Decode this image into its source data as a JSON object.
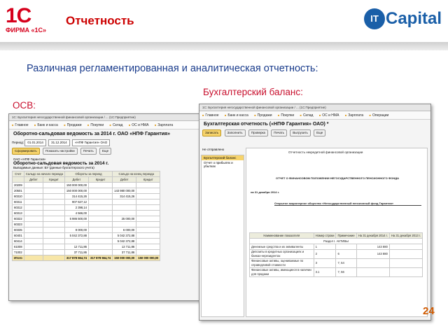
{
  "header": {
    "logo_1c_mark": "1С",
    "logo_1c_firm": "ФИРМА «1С»",
    "title": "Отчетность",
    "itcapital_ball": "IT",
    "itcapital_word": "Capital"
  },
  "subtitle": "Различная регламентированная и аналитическая отчетность:",
  "label_balance": "Бухгалтерский баланс:",
  "label_osv": "ОСВ:",
  "page_number": "24",
  "osv_window": {
    "titlebar": "1С: Бухгалтерия негосударственной финансовой организации / ... (1С:Предприятие)",
    "menu": [
      "Главное",
      "Банк и касса",
      "Продажи",
      "Покупки",
      "Склад",
      "ОС и НМА",
      "Зарплата"
    ],
    "doc_title": "Оборотно-сальдовая ведомость за 2014 г. ОАО «НПФ Гарантия»",
    "period_label": "Период:",
    "period_from": "01.01.2014",
    "period_to": "31.12.2014",
    "org": "«НПФ Гарантия» ОАО",
    "btn_form": "Сформировать",
    "btn_settings": "Показать настройки",
    "btn_print": "Печать",
    "btn_more": "Еще",
    "report_org": "ОАО «НПФ Гарантия»",
    "report_title": "Оборотно-сальдовая ведомость за 2014 г.",
    "report_note": "Выводимые данные: БУ (данные бухгалтерского учета)",
    "columns": [
      "Счет",
      "Сальдо на начало периода",
      "Обороты за период",
      "",
      "Сальдо на конец периода"
    ],
    "subcolumns": [
      "",
      "Дебет",
      "Кредит",
      "Дебет",
      "Кредит",
      "Дебет",
      "Кредит"
    ],
    "rows": [
      [
        "20209",
        "",
        "",
        "150 000 000,00",
        "",
        "",
        ""
      ],
      [
        "20501",
        "",
        "",
        "150 000 000,00",
        "",
        "143 980 000,00",
        ""
      ],
      [
        "60310",
        "",
        "",
        "314 415,26",
        "",
        "314 415,26",
        ""
      ],
      [
        "60311",
        "",
        "",
        "907 627,12",
        "",
        "",
        ""
      ],
      [
        "60312",
        "",
        "",
        "2 398,14",
        "",
        "",
        ""
      ],
      [
        "60313",
        "",
        "",
        "4 566,00",
        "",
        "",
        ""
      ],
      [
        "60322",
        "",
        "",
        "5 986 500,00",
        "",
        "25 000,00",
        ""
      ],
      [
        "60323",
        "",
        "",
        "",
        "",
        "",
        ""
      ],
      [
        "60335",
        "",
        "",
        "8 000,00",
        "",
        "6 000,00",
        ""
      ],
      [
        "60401",
        "",
        "",
        "5 042 372,88",
        "",
        "5 042 372,88",
        ""
      ],
      [
        "60414",
        "",
        "",
        "",
        "",
        "5 042 372,88",
        ""
      ],
      [
        "61008",
        "",
        "",
        "12 711,86",
        "",
        "12 711,86",
        ""
      ],
      [
        "71002",
        "",
        "",
        "37 711,86",
        "",
        "37 711,86",
        ""
      ]
    ],
    "total_label": "Итого",
    "total_values": [
      "",
      "",
      "317 878 564,74",
      "317 878 564,74",
      "150 000 000,00",
      "150 000 000,00"
    ]
  },
  "balance_window": {
    "titlebar": "1С: Бухгалтерия негосударственной финансовой организации / ... (1С:Предприятие)",
    "menu": [
      "Главное",
      "Банк и касса",
      "Продажи",
      "Покупки",
      "Склад",
      "ОС и НМА",
      "Зарплата",
      "Операции"
    ],
    "doc_title": "Бухгалтерская отчетность («НПФ Гарантия» ОАО) *",
    "btn_record": "Записать",
    "btn_fill": "Заполнить",
    "btn_check": "Проверка",
    "btn_print": "Печать",
    "btn_upload": "Выгрузить",
    "btn_more": "Еще",
    "status": "Не отправлено",
    "side_items": [
      "Бухгалтерский баланс",
      "Отчет о прибылях и убытках"
    ],
    "form_header": "Отчетность некредитной финансовой организации",
    "report_heading": "ОТЧЕТ О ФИНАНСОВОМ ПОЛОЖЕНИИ НЕГОСУДАРСТВЕННОГО ПЕНСИОННОГО ФОНДА",
    "report_date": "на 31 декабря 2014 г.",
    "org_name": "Открытое акционерное общество «Негосударственный пенсионный фонд Гарантия»",
    "table_headers": [
      "Наименование показателя",
      "Номер строки",
      "Примечание",
      "На 31 декабря 2014 г.",
      "На 31 декабря 2013 г."
    ],
    "section": "Раздел I. АКТИВЫ",
    "table_rows": [
      [
        "Денежные средства и их эквиваленты",
        "1",
        "",
        "143 880",
        ""
      ],
      [
        "Депозиты в кредитных организациях и банках-нерезидентах",
        "2",
        "6",
        "143 880",
        ""
      ],
      [
        "Финансовые активы, оцениваемые по справедливой стоимости",
        "3",
        "7, 54",
        "",
        ""
      ],
      [
        "Финансовые активы, имеющиеся в наличии для продажи",
        "3.1",
        "7, 56",
        "",
        ""
      ]
    ]
  }
}
